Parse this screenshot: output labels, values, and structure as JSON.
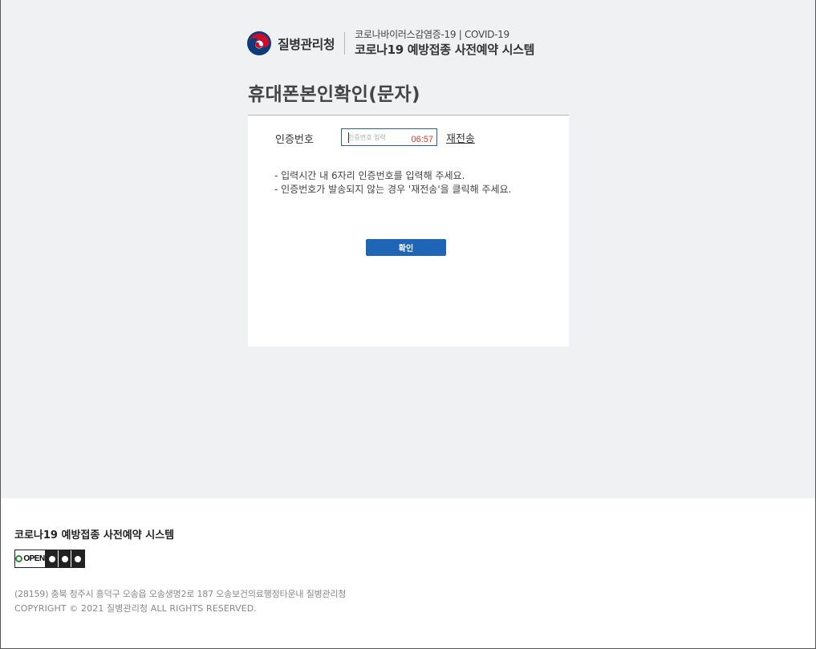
{
  "header": {
    "org_name": "질병관리청",
    "system_subtitle": "코로나바이러스감염증-19 | COVID-19",
    "system_title": "코로나19 예방접종 사전예약 시스템"
  },
  "page": {
    "title": "휴대폰본인확인(문자)"
  },
  "verification": {
    "label": "인증번호",
    "input_value": "",
    "input_placeholder": "인증번호 입력",
    "timer": "06:57",
    "resend_label": "재전송",
    "guide_line1": "- 입력시간 내 6자리 인증번호를 입력해 주세요.",
    "guide_line2": "- 인증번호가 발송되지 않는 경우 '재전송'을 클릭해 주세요.",
    "confirm_label": "확인"
  },
  "footer": {
    "title": "코로나19 예방접종 사전예약 시스템",
    "license_badge": "OPEN",
    "address": "(28159) 충북 청주시 흥덕구 오송읍 오송생명2로 187 오송보건의료행정타운내 질병관리청",
    "copyright": "COPYRIGHT © 2021 질병관리청 ALL RIGHTS RESERVED."
  },
  "colors": {
    "background": "#f0f1f3",
    "accent": "#1e66b5",
    "timer": "#e0342c",
    "logo_red": "#c8102e",
    "logo_blue": "#0f3b7a"
  },
  "icons": {
    "logo": "taegeuk-logo-icon",
    "license_icons": [
      "attribution-icon",
      "noncommercial-icon",
      "no-derivatives-icon"
    ]
  }
}
